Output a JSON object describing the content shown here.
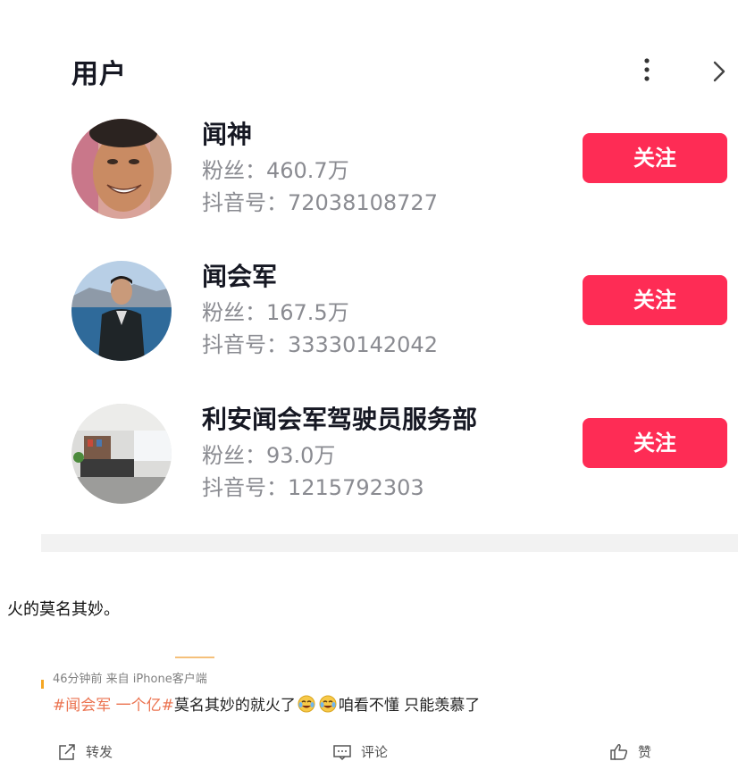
{
  "section": {
    "title": "用户"
  },
  "users": [
    {
      "name": "闻神",
      "fans": "粉丝：460.7万",
      "douyin_id": "抖音号：72038108727",
      "follow_label": "关注"
    },
    {
      "name": "闻会军",
      "fans": "粉丝：167.5万",
      "douyin_id": "抖音号：33330142042",
      "follow_label": "关注"
    },
    {
      "name": "利安闻会军驾驶员服务部",
      "fans": "粉丝：93.0万",
      "douyin_id": "抖音号：1215792303",
      "follow_label": "关注"
    }
  ],
  "caption": "火的莫名其妙。",
  "weibo": {
    "meta": "46分钟前  来自 iPhone客户端",
    "hashtag": "#闻会军 一个亿#",
    "text_before_emoji": "莫名其妙的就火了",
    "text_after_emoji": "咱看不懂 只能羡慕了",
    "actions": {
      "repost": "转发",
      "comment": "评论",
      "like": "赞"
    }
  },
  "colors": {
    "follow_button": "#fe2c55",
    "hashtag": "#eb7350",
    "secondary_text": "#8a8b91"
  },
  "icons": [
    "more-vertical-icon",
    "chevron-right-icon",
    "repost-icon",
    "comment-icon",
    "like-icon",
    "crying-laughing-emoji-icon"
  ]
}
